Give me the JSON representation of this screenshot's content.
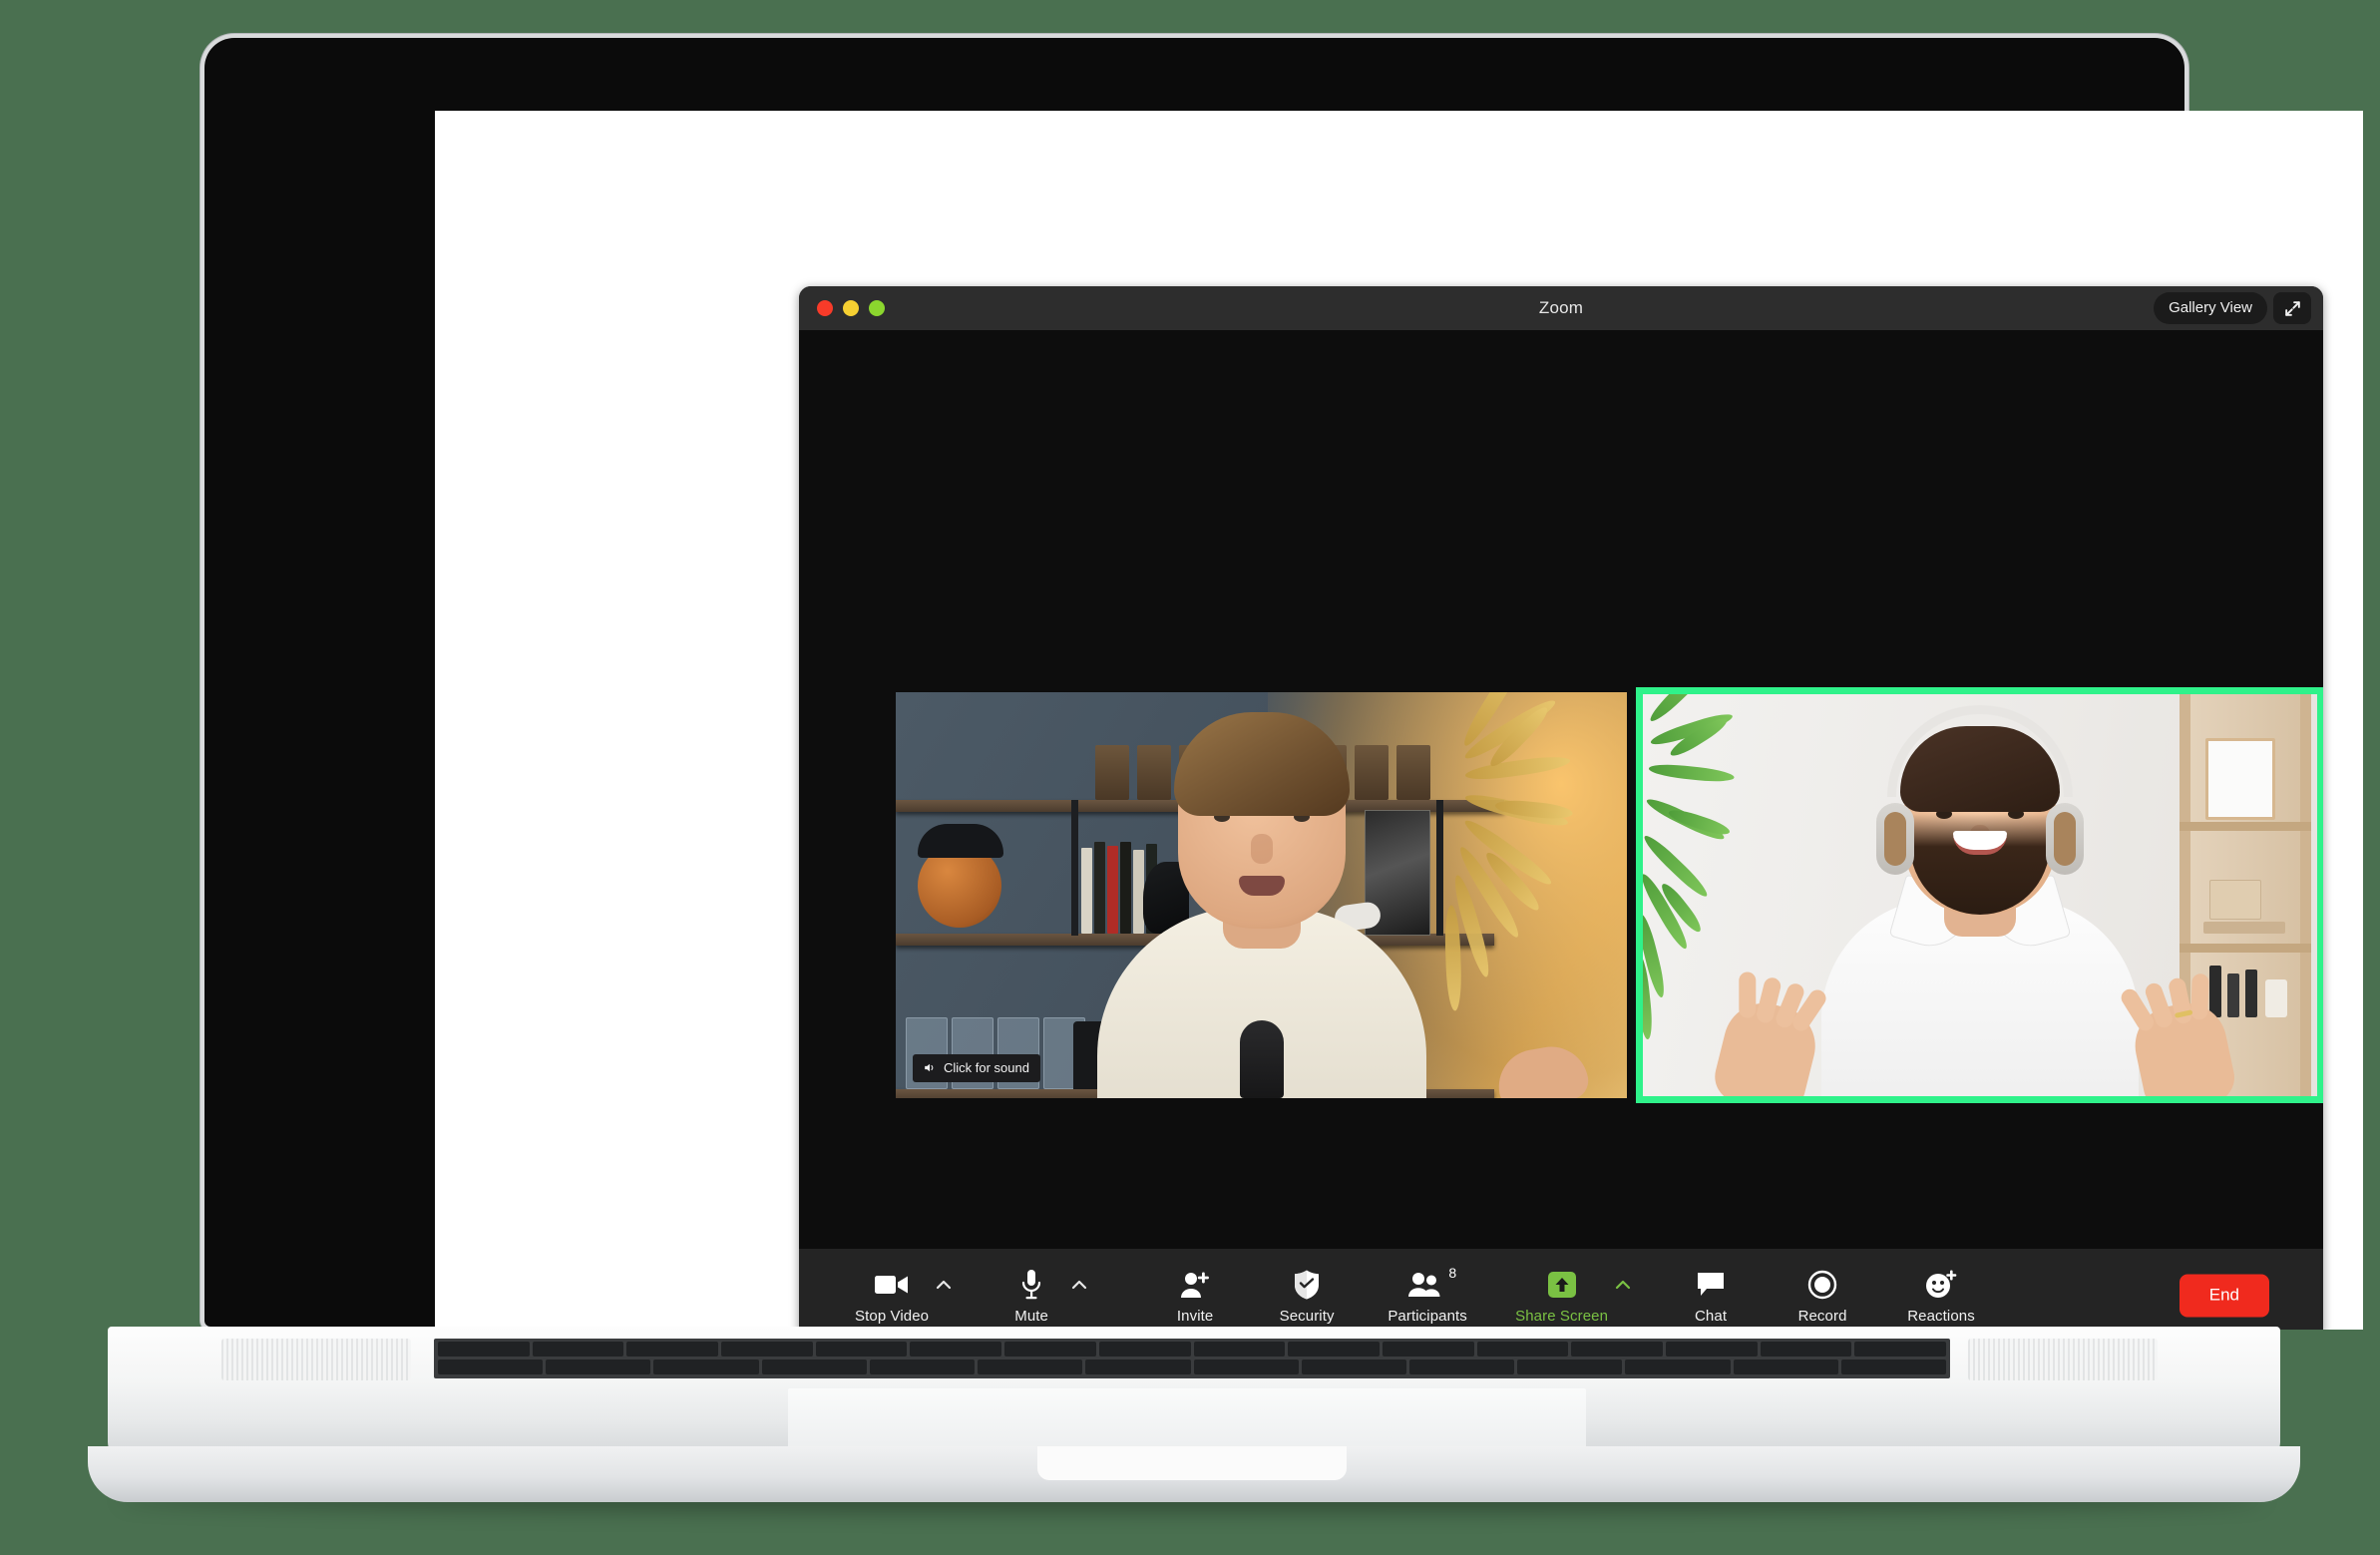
{
  "app": {
    "window_title": "Zoom",
    "titlebar": {
      "traffic_lights": [
        "close-red",
        "minimize-yellow",
        "maximize-green"
      ],
      "gallery_view_label": "Gallery View",
      "fullscreen_icon": "expand-arrows-icon"
    }
  },
  "stage": {
    "tiles": [
      {
        "id": "participant-left",
        "active_speaker": false,
        "overlay_badge": {
          "icon": "speaker-sound-icon",
          "label": "Click for sound"
        }
      },
      {
        "id": "participant-right",
        "active_speaker": true,
        "highlight_color": "#2ff28a"
      }
    ]
  },
  "toolbar": {
    "background": "#242424",
    "items": [
      {
        "key": "video",
        "icon": "video-camera-icon",
        "label": "Stop Video",
        "has_caret": true,
        "caret_icon": "chevron-up-icon"
      },
      {
        "key": "audio",
        "icon": "microphone-icon",
        "label": "Mute",
        "has_caret": true,
        "caret_icon": "chevron-up-icon"
      },
      {
        "key": "invite",
        "icon": "person-plus-icon",
        "label": "Invite",
        "has_caret": false
      },
      {
        "key": "security",
        "icon": "shield-icon",
        "label": "Security",
        "has_caret": false
      },
      {
        "key": "participants",
        "icon": "people-icon",
        "label": "Participants",
        "has_caret": false,
        "badge": "8"
      },
      {
        "key": "share",
        "icon": "share-arrow-icon",
        "label": "Share Screen",
        "has_caret": true,
        "caret_icon": "chevron-up-icon",
        "accent": "#7ac143"
      },
      {
        "key": "chat",
        "icon": "chat-bubble-icon",
        "label": "Chat",
        "has_caret": false
      },
      {
        "key": "record",
        "icon": "record-circle-icon",
        "label": "Record",
        "has_caret": false
      },
      {
        "key": "reactions",
        "icon": "smiley-plus-icon",
        "label": "Reactions",
        "has_caret": false
      }
    ],
    "end_button": {
      "label": "End",
      "color": "#f02a1e"
    }
  },
  "theme": {
    "page_background": "#4a7050",
    "window_background": "#0d0d0d",
    "titlebar_background": "#2d2d2d",
    "active_speaker_border": "#2ff28a",
    "share_screen_green": "#7ac143",
    "end_red": "#f02a1e"
  }
}
